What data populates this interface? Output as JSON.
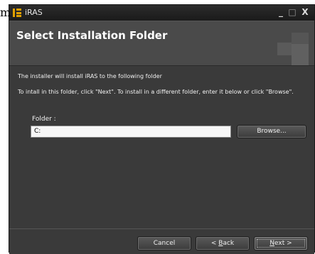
{
  "stray_text": "m",
  "window": {
    "title": "iRAS",
    "buttons": {
      "minimize": "_",
      "maximize": "□",
      "close": "X"
    }
  },
  "header": {
    "title": "Select Installation Folder"
  },
  "content": {
    "description_line1": "The installer will install iRAS to the following folder",
    "description_line2": "To intall in this folder, click \"Next\". To install in a different folder, enter it below or click \"Browse\".",
    "folder_label": "Folder :",
    "folder_value": "C:",
    "browse_label": "Browse..."
  },
  "footer": {
    "cancel_label": "Cancel",
    "back_prefix": "< ",
    "back_mnemonic": "B",
    "back_rest": "ack",
    "next_mnemonic": "N",
    "next_rest": "ext >"
  },
  "colors": {
    "window_bg": "#3a3a3a",
    "header_bg": "#4a4a4a",
    "text": "#f0f0f0",
    "icon_accent": "#e0a000"
  },
  "icons": [
    "app-icon",
    "minimize-icon",
    "maximize-icon",
    "close-icon",
    "header-logo-icon"
  ]
}
